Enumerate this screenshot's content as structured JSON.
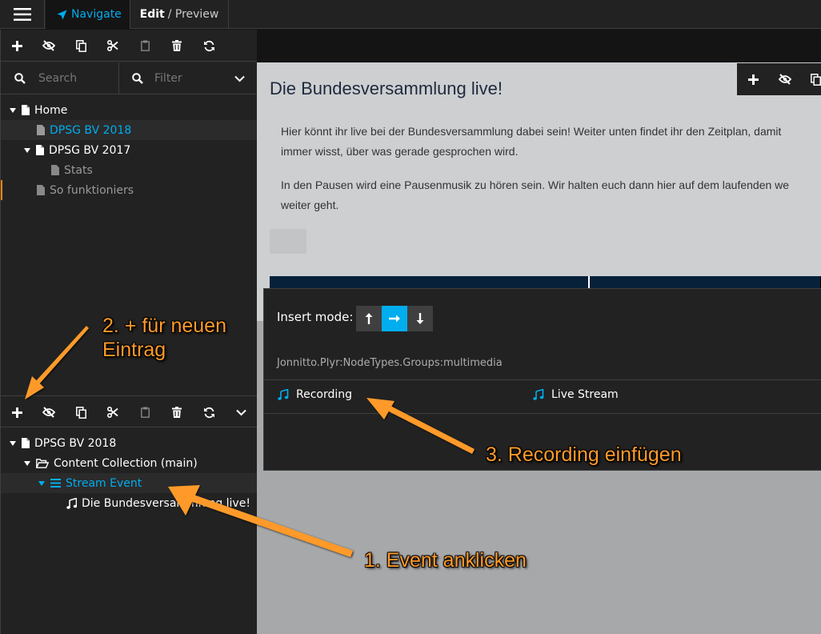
{
  "topbar": {
    "navigate_label": "Navigate",
    "edit_label": "Edit",
    "preview_label": "/ Preview"
  },
  "sidebar": {
    "search_placeholder": "Search",
    "filter_placeholder": "Filter",
    "page_tree": [
      {
        "label": "Home"
      },
      {
        "label": "DPSG BV 2018"
      },
      {
        "label": "DPSG BV 2017"
      },
      {
        "label": "Stats"
      },
      {
        "label": "So funktioniers"
      }
    ],
    "content_tree": [
      {
        "label": "DPSG BV 2018"
      },
      {
        "label": "Content Collection (main)"
      },
      {
        "label": "Stream Event"
      },
      {
        "label": "Die Bundesversammlung live!"
      }
    ]
  },
  "page": {
    "title": "Die Bundesversammlung live!",
    "para1_line1": "Hier könnt ihr live bei der Bundesversammlung dabei sein! Weiter unten findet ihr den Zeitplan, damit",
    "para1_line2": "immer wisst, über was gerade gesprochen wird.",
    "para2_line1": "In den Pausen wird eine Pausenmusik zu hören sein. Wir halten euch dann hier auf dem laufenden we",
    "para2_line2": "weiter geht."
  },
  "insert_dialog": {
    "mode_label": "Insert mode:",
    "group_title": "Jonnitto.Plyr:NodeTypes.Groups:multimedia",
    "node_types": [
      {
        "label": "Recording"
      },
      {
        "label": "Live Stream"
      }
    ]
  },
  "annotations": {
    "step1": "1. Event anklicken",
    "step2_line1": "2. + für neuen",
    "step2_line2": "Eintrag",
    "step3": "3. Recording einfügen"
  },
  "colors": {
    "accent": "#00adee",
    "annotation": "#ff9a2a"
  }
}
